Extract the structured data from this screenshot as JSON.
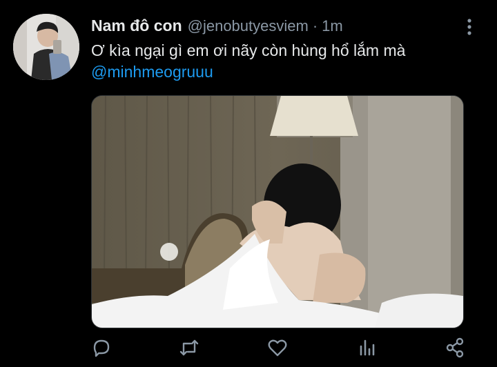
{
  "tweet": {
    "author_name": "Nam đô con",
    "handle": "@jenobutyesviem",
    "separator": "·",
    "time": "1m",
    "text": "Ơ kìa ngại gì em ơi nãy còn hùng hổ lắm mà",
    "mention": "@minhmeogruuu"
  },
  "icons": {
    "more": "more-vertical-icon",
    "reply": "reply-icon",
    "retweet": "retweet-icon",
    "like": "heart-icon",
    "stats": "analytics-icon",
    "share": "share-icon"
  },
  "colors": {
    "background": "#000000",
    "text": "#e7e9ea",
    "secondary": "#8b98a5",
    "link": "#1d9bf0",
    "icon": "#8b98a5"
  }
}
